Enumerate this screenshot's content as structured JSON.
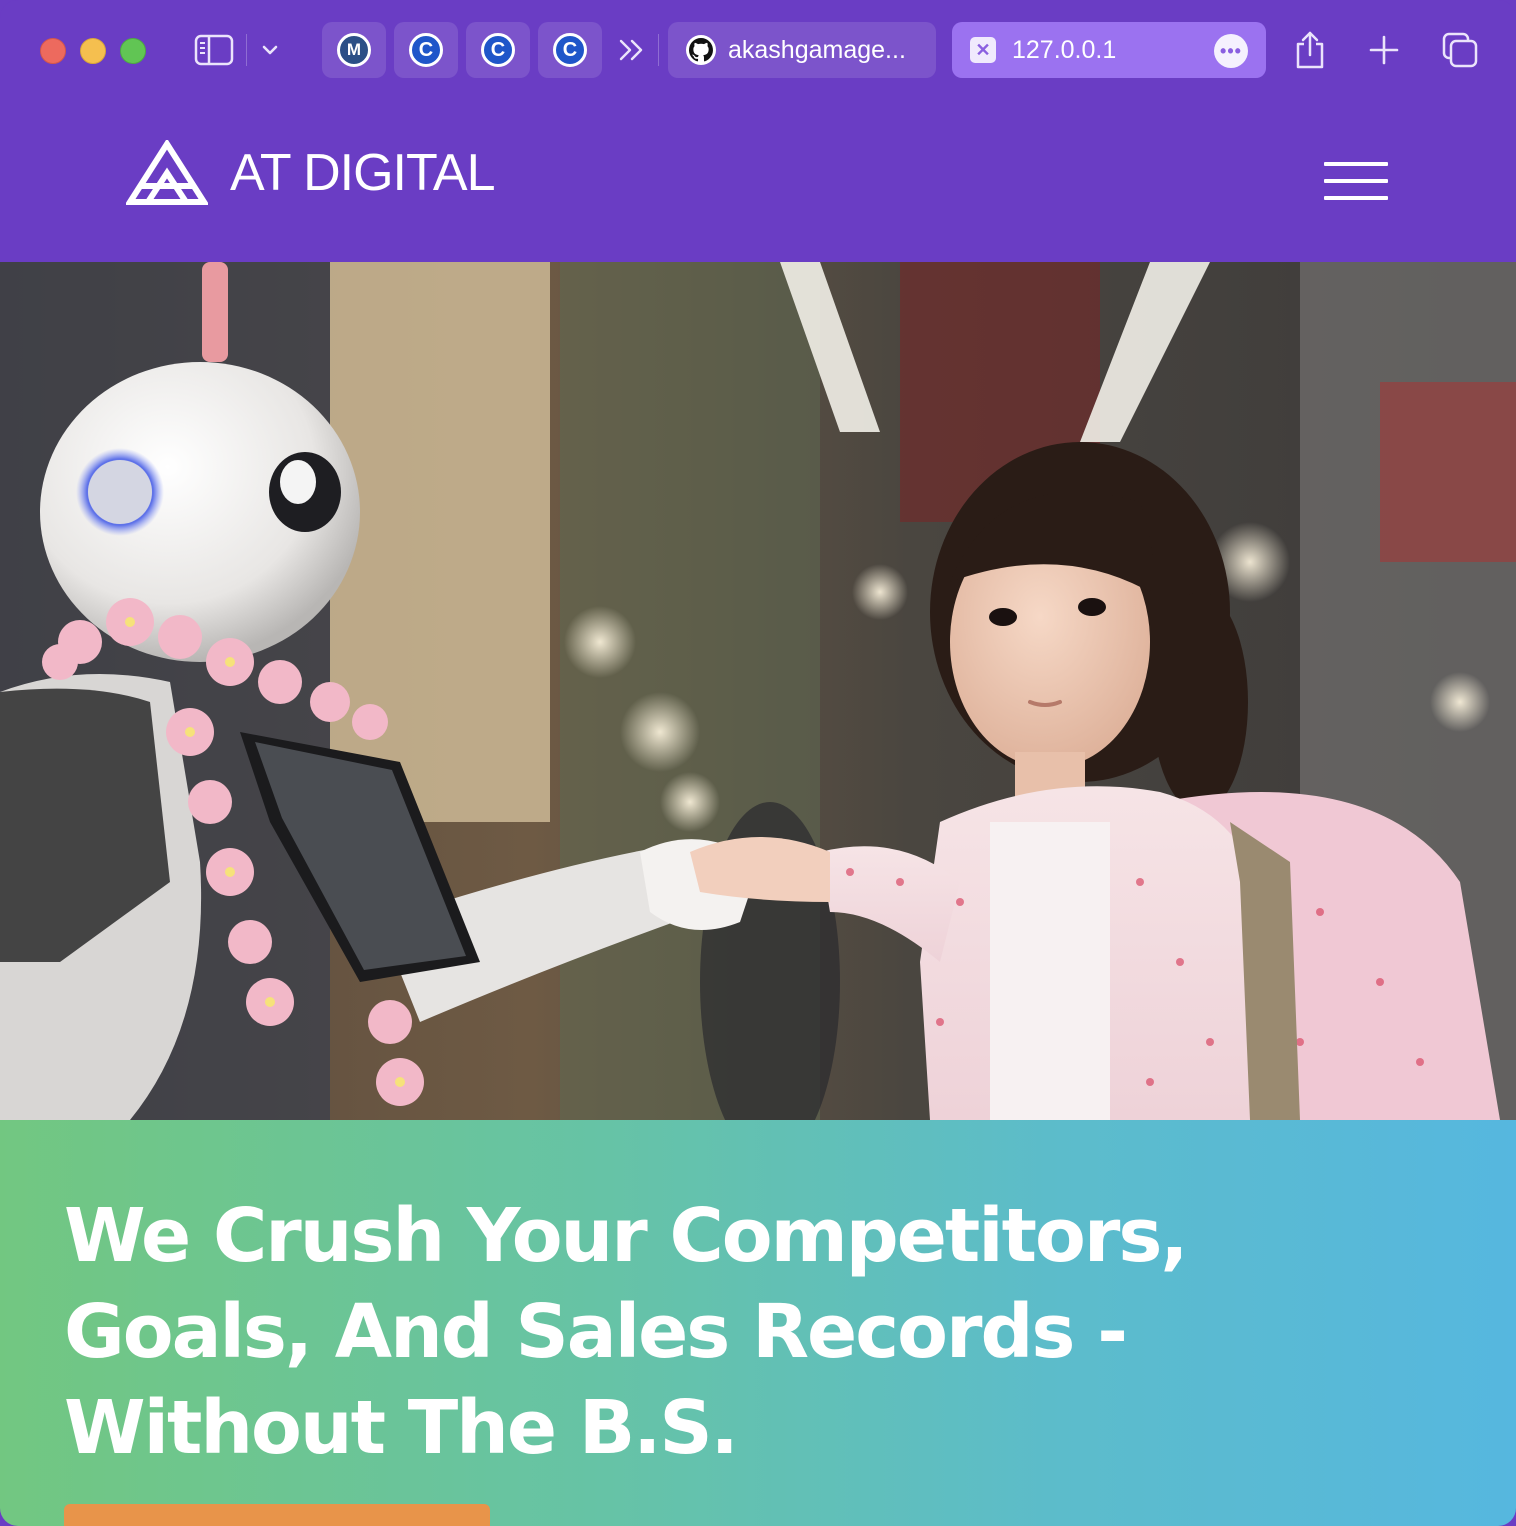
{
  "browser": {
    "pinned_tabs": [
      {
        "icon": "m-circle-icon",
        "glyph": "M"
      },
      {
        "icon": "c-circle-icon",
        "glyph": "C"
      },
      {
        "icon": "c-circle-icon",
        "glyph": "C"
      },
      {
        "icon": "c-circle-icon",
        "glyph": "C"
      }
    ],
    "tabs": [
      {
        "title": "akashgamage...",
        "icon": "github-icon"
      },
      {
        "title": "127.0.0.1",
        "icon": "close-icon",
        "active": true
      }
    ],
    "colors": {
      "chrome": "#6a3dc4",
      "active_tab": "#9b72f0"
    }
  },
  "site": {
    "logo_text": "AT DIGITAL",
    "nav_icon": "hamburger-menu-icon",
    "hero": {
      "image": "photo of a white humanoid robot with pink flower garland holding hands with a young girl in a market",
      "title": "We Crush Your Competitors, Goals, And Sales Records - Without The B.S.",
      "cta_color": "#e8944a"
    },
    "colors": {
      "header": "#6a3dc4",
      "gradient_start": "#72c781",
      "gradient_end": "#56b7df"
    }
  }
}
